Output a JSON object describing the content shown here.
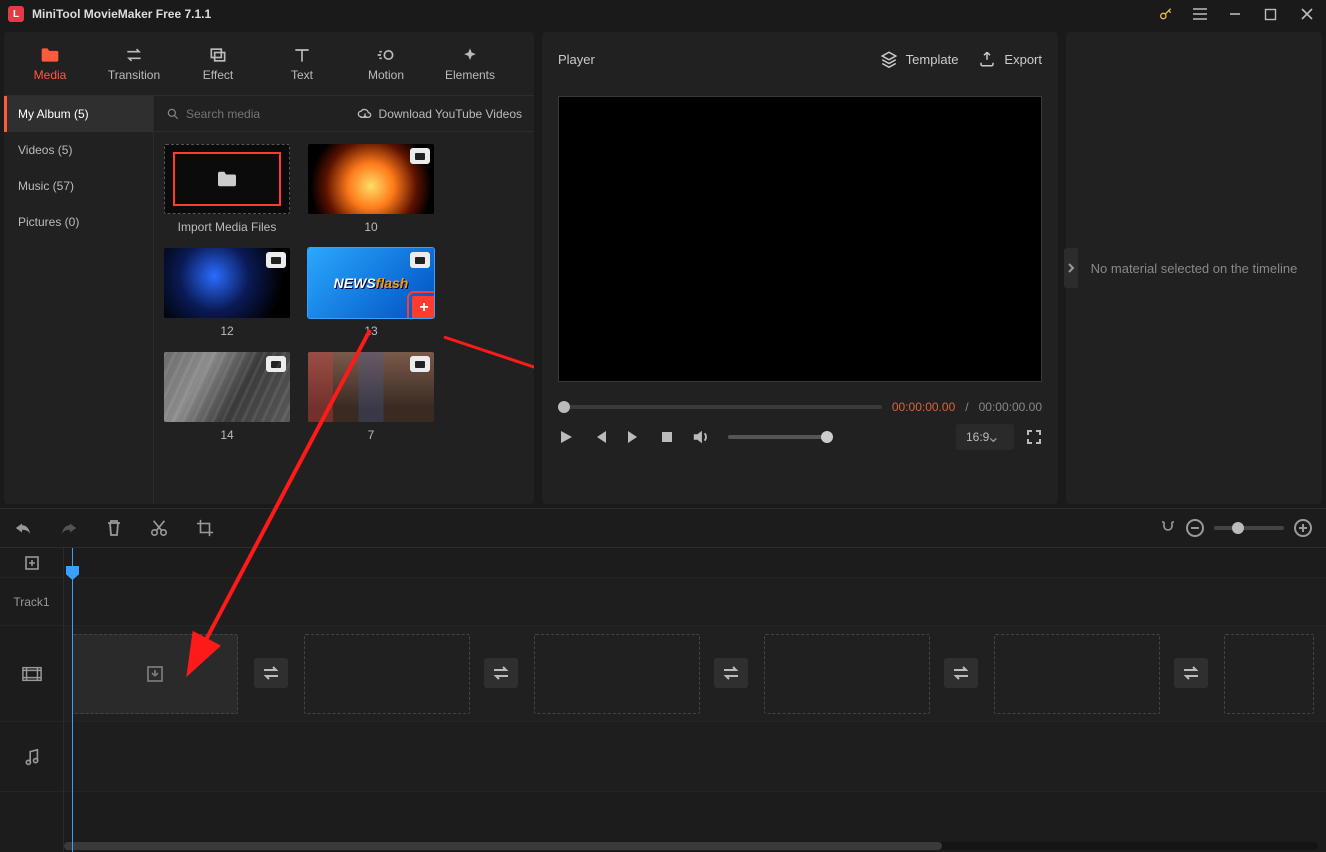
{
  "app": {
    "title": "MiniTool MovieMaker Free 7.1.1"
  },
  "tabs": [
    {
      "label": "Media",
      "icon": "folder"
    },
    {
      "label": "Transition",
      "icon": "swap"
    },
    {
      "label": "Effect",
      "icon": "layers"
    },
    {
      "label": "Text",
      "icon": "text"
    },
    {
      "label": "Motion",
      "icon": "motion"
    },
    {
      "label": "Elements",
      "icon": "sparkle"
    }
  ],
  "sidebar": {
    "items": [
      {
        "label": "My Album (5)"
      },
      {
        "label": "Videos (5)"
      },
      {
        "label": "Music (57)"
      },
      {
        "label": "Pictures (0)"
      }
    ]
  },
  "media": {
    "search_placeholder": "Search media",
    "download_label": "Download YouTube Videos",
    "import_label": "Import Media Files",
    "items": [
      {
        "name": "10"
      },
      {
        "name": "12"
      },
      {
        "name": "13"
      },
      {
        "name": "14"
      },
      {
        "name": "7"
      }
    ]
  },
  "player": {
    "title": "Player",
    "template_label": "Template",
    "export_label": "Export",
    "time_current": "00:00:00.00",
    "time_sep": " / ",
    "time_total": "00:00:00.00",
    "ratio": "16:9"
  },
  "properties": {
    "empty_msg": "No material selected on the timeline"
  },
  "timeline": {
    "track_label": "Track1"
  }
}
